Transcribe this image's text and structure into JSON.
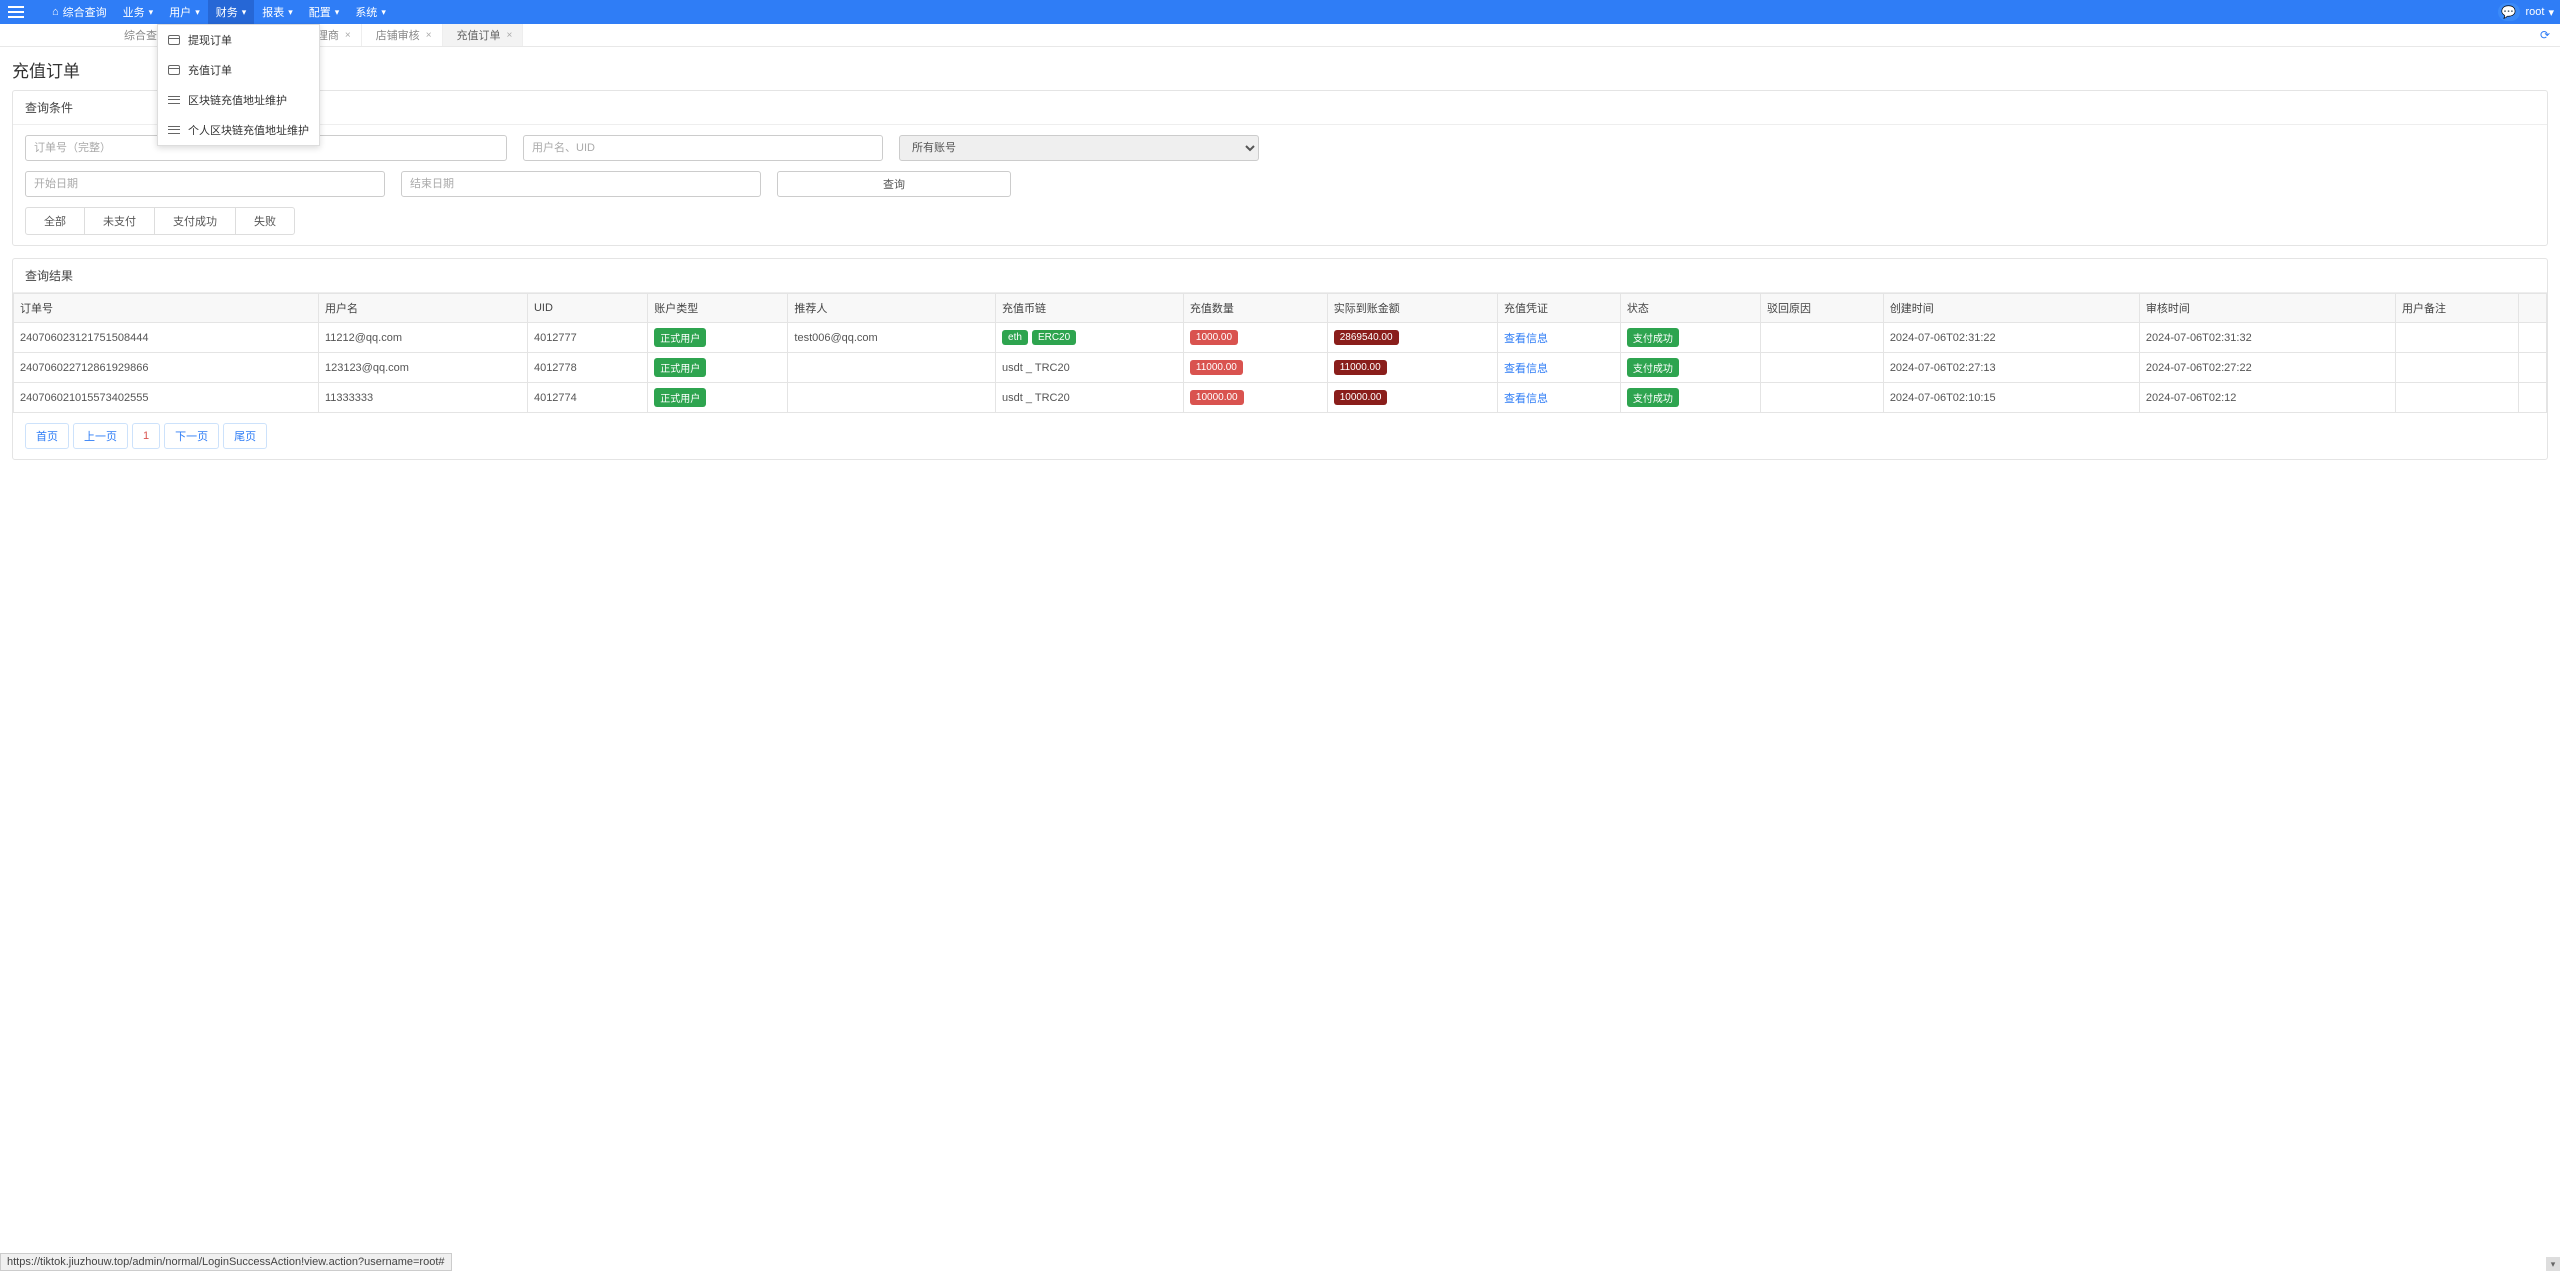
{
  "nav": {
    "综合查询": "综合查询",
    "业务": "业务",
    "用户": "用户",
    "财务": "财务",
    "服表": "报表",
    "配置": "配置",
    "系统": "系统",
    "user": "root"
  },
  "dropdown": {
    "提现订单": "提现订单",
    "充值订单": "充值订单",
    "区块链充值地址维护": "区块链充值地址维护",
    "个人区块链充值地址维护": "个人区块链充值地址维护"
  },
  "tabs": {
    "综合查询": "综合查询",
    "代理商": "代理商",
    "店铺审核": "店铺审核",
    "充值订单": "充值订单"
  },
  "page": {
    "title": "充值订单",
    "search_title": "查询条件",
    "results_title": "查询结果",
    "placeholders": {
      "order": "订单号（完整）",
      "user": "用户名、UID",
      "account": "所有账号",
      "start": "开始日期",
      "end": "结束日期"
    },
    "search_btn": "查询",
    "filters": {
      "all": "全部",
      "unpaid": "未支付",
      "paid": "支付成功",
      "failed": "失败"
    }
  },
  "table": {
    "headers": {
      "order_no": "订单号",
      "username": "用户名",
      "uid": "UID",
      "account_type": "账户类型",
      "referrer": "推荐人",
      "chain": "充值币链",
      "amount": "充值数量",
      "actual": "实际到账金额",
      "voucher": "充值凭证",
      "status": "状态",
      "reject_reason": "驳回原因",
      "created": "创建时间",
      "audited": "审核时间",
      "remark": "用户备注"
    },
    "rows": [
      {
        "order_no": "240706023121751508444",
        "username": "11212@qq.com",
        "uid": "4012777",
        "account_type": "正式用户",
        "referrer": "test006@qq.com",
        "chain_eth": "eth",
        "chain_erc": "ERC20",
        "amount": "1000.00",
        "actual": "2869540.00",
        "voucher": "查看信息",
        "status": "支付成功",
        "created": "2024-07-06T02:31:22",
        "audited": "2024-07-06T02:31:32"
      },
      {
        "order_no": "240706022712861929866",
        "username": "123123@qq.com",
        "uid": "4012778",
        "account_type": "正式用户",
        "referrer": "",
        "chain_text": "usdt _ TRC20",
        "amount": "11000.00",
        "actual": "11000.00",
        "voucher": "查看信息",
        "status": "支付成功",
        "created": "2024-07-06T02:27:13",
        "audited": "2024-07-06T02:27:22"
      },
      {
        "order_no": "240706021015573402555",
        "username": "11333333",
        "uid": "4012774",
        "account_type": "正式用户",
        "referrer": "",
        "chain_text": "usdt _ TRC20",
        "amount": "10000.00",
        "actual": "10000.00",
        "voucher": "查看信息",
        "status": "支付成功",
        "created": "2024-07-06T02:10:15",
        "audited": "2024-07-06T02:12"
      }
    ]
  },
  "pagination": {
    "first": "首页",
    "prev": "上一页",
    "page": "1",
    "next": "下一页",
    "last": "尾页"
  },
  "status_url": "https://tiktok.jiuzhouw.top/admin/normal/LoginSuccessAction!view.action?username=root#"
}
